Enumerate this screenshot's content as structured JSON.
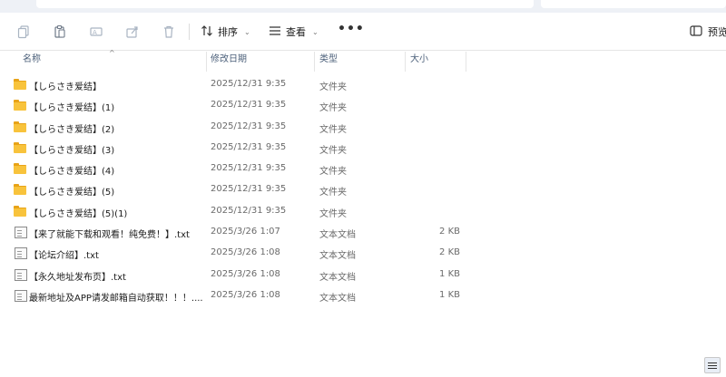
{
  "toolbar": {
    "sort_label": "排序",
    "view_label": "查看",
    "more_label": "•••",
    "preview_label": "预览"
  },
  "columns": {
    "name": "名称",
    "modified": "修改日期",
    "type": "类型",
    "size": "大小"
  },
  "files": [
    {
      "name": "【しらさき爱结】",
      "modified": "2025/12/31 9:35",
      "type": "文件夹",
      "size": "",
      "kind": "folder"
    },
    {
      "name": "【しらさき爱结】(1)",
      "modified": "2025/12/31 9:35",
      "type": "文件夹",
      "size": "",
      "kind": "folder"
    },
    {
      "name": "【しらさき爱结】(2)",
      "modified": "2025/12/31 9:35",
      "type": "文件夹",
      "size": "",
      "kind": "folder"
    },
    {
      "name": "【しらさき爱结】(3)",
      "modified": "2025/12/31 9:35",
      "type": "文件夹",
      "size": "",
      "kind": "folder"
    },
    {
      "name": "【しらさき爱结】(4)",
      "modified": "2025/12/31 9:35",
      "type": "文件夹",
      "size": "",
      "kind": "folder"
    },
    {
      "name": "【しらさき爱结】(5)",
      "modified": "2025/12/31 9:35",
      "type": "文件夹",
      "size": "",
      "kind": "folder"
    },
    {
      "name": "【しらさき爱结】(5)(1)",
      "modified": "2025/12/31 9:35",
      "type": "文件夹",
      "size": "",
      "kind": "folder"
    },
    {
      "name": "【来了就能下载和观看！纯免费！】.txt",
      "modified": "2025/3/26 1:07",
      "type": "文本文档",
      "size": "2 KB",
      "kind": "file"
    },
    {
      "name": "【论坛介绍】.txt",
      "modified": "2025/3/26 1:08",
      "type": "文本文档",
      "size": "2 KB",
      "kind": "file"
    },
    {
      "name": "【永久地址发布页】.txt",
      "modified": "2025/3/26 1:08",
      "type": "文本文档",
      "size": "1 KB",
      "kind": "file"
    },
    {
      "name": "最新地址及APP请发邮箱自动获取！！！....",
      "modified": "2025/3/26 1:08",
      "type": "文本文档",
      "size": "1 KB",
      "kind": "file"
    }
  ],
  "colors": {
    "folder": "#f8c33c",
    "header_text": "#4c607a",
    "secondary_text": "#6a6a6a"
  }
}
